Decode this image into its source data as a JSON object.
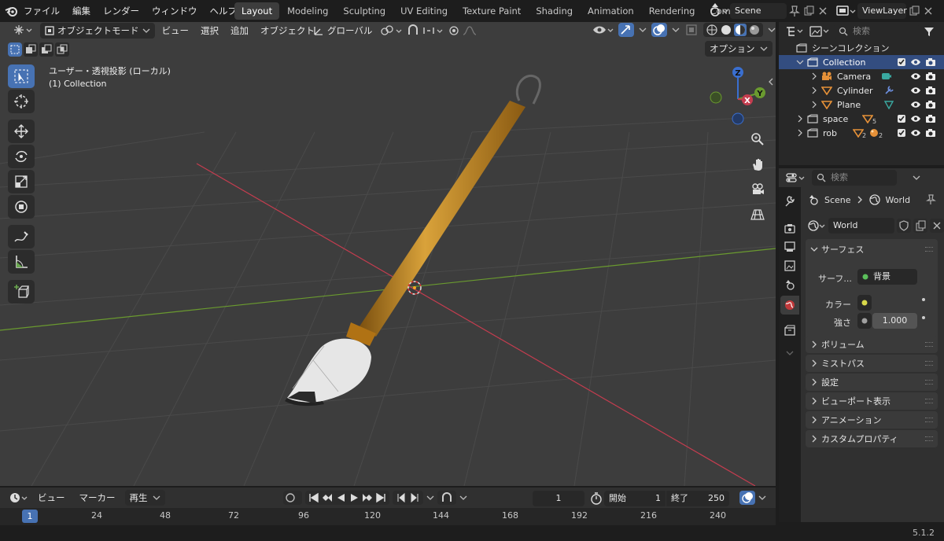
{
  "topbar": {
    "menus": [
      "ファイル",
      "編集",
      "レンダー",
      "ウィンドウ",
      "ヘルプ"
    ],
    "workspaces": [
      "Layout",
      "Modeling",
      "Sculpting",
      "UV Editing",
      "Texture Paint",
      "Shading",
      "Animation",
      "Rendering",
      "Compositing"
    ],
    "active_workspace": "Layout",
    "scene_name": "Scene",
    "viewlayer_name": "ViewLayer"
  },
  "viewport": {
    "mode": "オブジェクトモード",
    "menu": [
      "ビュー",
      "選択",
      "追加",
      "オブジェクト"
    ],
    "transform_orientation": "グローバル",
    "options_label": "オプション",
    "view_name": "ユーザー・透視投影 (ローカル)",
    "collection_info": "(1) Collection",
    "gizmo_axes": {
      "x": "X",
      "y": "Y",
      "z": "Z"
    },
    "colors": {
      "bg": "#3d3d3d",
      "x_axis": "#c43d4f",
      "y_axis": "#6a9a2f",
      "z_axis": "#3a6fd0",
      "accent": "#4772b3"
    }
  },
  "timeline": {
    "menu": [
      "ビュー",
      "マーカー"
    ],
    "playback_label": "再生",
    "current_frame": "1",
    "start_label": "開始",
    "start_value": "1",
    "end_label": "終了",
    "end_value": "250",
    "ruler": [
      "1",
      "24",
      "48",
      "72",
      "96",
      "120",
      "144",
      "168",
      "192",
      "216",
      "240"
    ]
  },
  "outliner": {
    "search_placeholder": "検索",
    "items": [
      {
        "label": "シーンコレクション"
      },
      {
        "label": "Collection"
      },
      {
        "label": "Camera"
      },
      {
        "label": "Cylinder"
      },
      {
        "label": "Plane"
      },
      {
        "label": "space",
        "badge": "5"
      },
      {
        "label": "rob",
        "badge1": "2",
        "badge2": "2"
      }
    ]
  },
  "properties": {
    "search_placeholder": "検索",
    "breadcrumb_scene": "Scene",
    "breadcrumb_world": "World",
    "world_name": "World",
    "surface_panel": "サーフェス",
    "surface_label": "サーフ...",
    "surface_value": "背景",
    "color_label": "カラー",
    "strength_label": "強さ",
    "strength_value": "1.000",
    "panels": [
      "ボリューム",
      "ミストパス",
      "設定",
      "ビューポート表示",
      "アニメーション",
      "カスタムプロパティ"
    ]
  },
  "status": {
    "version": "5.1.2"
  }
}
